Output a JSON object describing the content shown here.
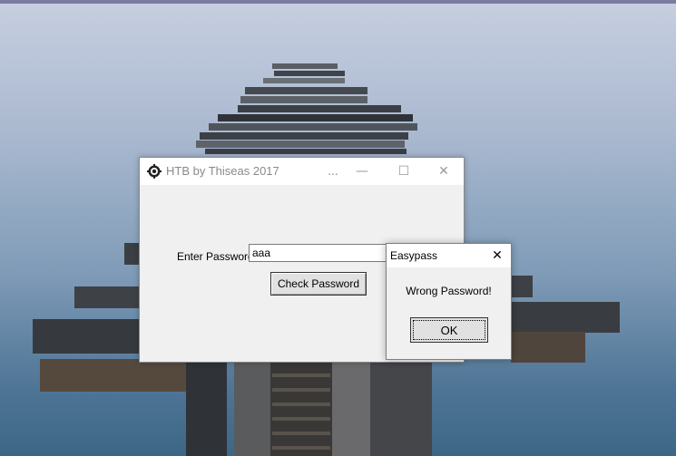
{
  "main_window": {
    "title": "HTB by Thiseas 2017",
    "more_glyph": "...",
    "minimize_glyph": "—",
    "maximize_glyph": "☐",
    "close_glyph": "✕",
    "icon": "gear-app-icon",
    "password_label": "Enter Password",
    "password_value": "aaa",
    "check_button_label": "Check Password"
  },
  "message_box": {
    "title": "Easypass",
    "close_glyph": "✕",
    "message": "Wrong Password!",
    "ok_label": "OK"
  },
  "colors": {
    "title_text_inactive": "#8a8a8a",
    "window_bg": "#f0f0f0",
    "button_bg": "#e1e1e1"
  }
}
